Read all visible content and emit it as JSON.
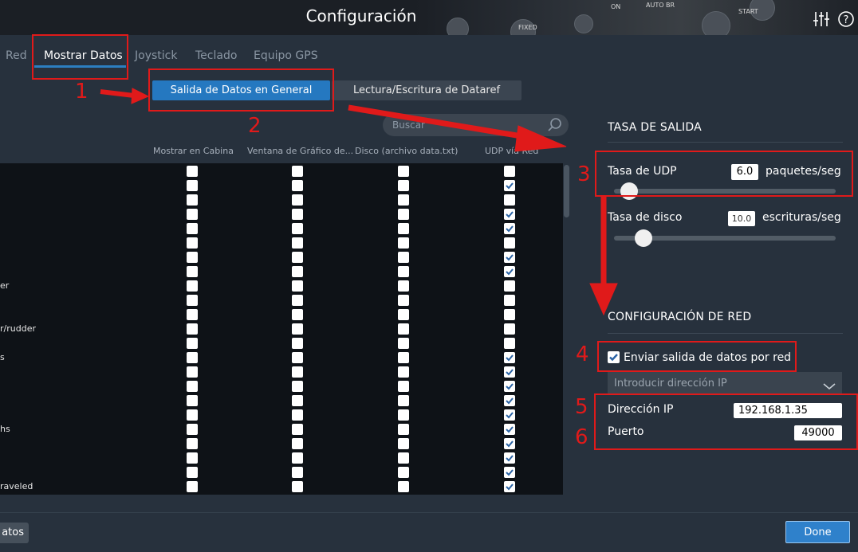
{
  "header": {
    "title": "Configuración",
    "deco_texts": [
      "ON",
      "AUTO BR",
      "FIXED",
      "START"
    ]
  },
  "tabs": [
    {
      "label": "Red"
    },
    {
      "label": "Mostrar Datos"
    },
    {
      "label": "Joystick"
    },
    {
      "label": "Teclado"
    },
    {
      "label": "Equipo GPS"
    }
  ],
  "segmented": {
    "general": "Salida de Datos en General",
    "dataref": "Lectura/Escritura de Dataref"
  },
  "search": {
    "placeholder": "Buscar"
  },
  "columns": [
    "Mostrar en Cabina",
    "Ventana de Gráfico de...",
    "Disco (archivo data.txt)",
    "UDP vía Red"
  ],
  "rows": [
    {
      "label": "",
      "udp": false
    },
    {
      "label": "",
      "udp": true
    },
    {
      "label": "",
      "udp": false
    },
    {
      "label": "",
      "udp": true
    },
    {
      "label": "",
      "udp": true
    },
    {
      "label": "",
      "udp": false
    },
    {
      "label": "",
      "udp": true
    },
    {
      "label": "",
      "udp": true
    },
    {
      "label": "er",
      "udp": false
    },
    {
      "label": "",
      "udp": false
    },
    {
      "label": "",
      "udp": false
    },
    {
      "label": "r/rudder",
      "udp": false
    },
    {
      "label": "",
      "udp": false
    },
    {
      "label": "s",
      "udp": true
    },
    {
      "label": "",
      "udp": true
    },
    {
      "label": "",
      "udp": true
    },
    {
      "label": "",
      "udp": true
    },
    {
      "label": "",
      "udp": true
    },
    {
      "label": "hs",
      "udp": true
    },
    {
      "label": "",
      "udp": true
    },
    {
      "label": "",
      "udp": true
    },
    {
      "label": "",
      "udp": true
    },
    {
      "label": "raveled",
      "udp": true
    },
    {
      "label": "",
      "udp": false
    },
    {
      "label": "",
      "udp": false
    }
  ],
  "output_rate": {
    "heading": "TASA DE SALIDA",
    "udp_label": "Tasa de UDP",
    "udp_value": "6.0",
    "udp_unit": "paquetes/seg",
    "udp_slider_fraction": 0.03,
    "disk_label": "Tasa de disco",
    "disk_value": "10.0",
    "disk_unit": "escrituras/seg",
    "disk_slider_fraction": 0.1
  },
  "network": {
    "heading": "CONFIGURACIÓN DE RED",
    "send_label": "Enviar salida de datos por red",
    "send_checked": true,
    "ip_dropdown": "Introducir dirección IP",
    "ip_label": "Dirección IP",
    "ip_value": "192.168.1.35",
    "port_label": "Puerto",
    "port_value": "49000"
  },
  "bottom": {
    "left_button": "atos",
    "done": "Done"
  },
  "annotations": [
    "1",
    "2",
    "3",
    "4",
    "5",
    "6"
  ],
  "colors": {
    "accent": "#2578c0",
    "annotation": "#e01a1a",
    "background": "#27313d",
    "list_bg": "#0e1217"
  }
}
